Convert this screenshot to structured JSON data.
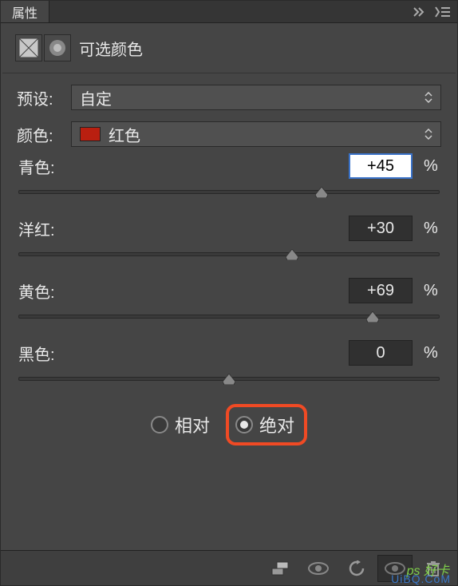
{
  "header": {
    "tab_title": "属性"
  },
  "panel": {
    "title": "可选颜色"
  },
  "preset": {
    "label": "预设:",
    "value": "自定"
  },
  "color": {
    "label": "颜色:",
    "value": "红色",
    "swatch": "#b91f10"
  },
  "sliders": {
    "cyan": {
      "label": "青色:",
      "value": "+45",
      "pct": "%",
      "pos": 72
    },
    "magenta": {
      "label": "洋红:",
      "value": "+30",
      "pct": "%",
      "pos": 65
    },
    "yellow": {
      "label": "黄色:",
      "value": "+69",
      "pct": "%",
      "pos": 84
    },
    "black": {
      "label": "黑色:",
      "value": "0",
      "pct": "%",
      "pos": 50
    }
  },
  "method": {
    "relative": "相对",
    "absolute": "绝对",
    "selected": "absolute"
  },
  "watermark": {
    "main": "ps 好卡",
    "sub": "UiBQ.CoM"
  }
}
